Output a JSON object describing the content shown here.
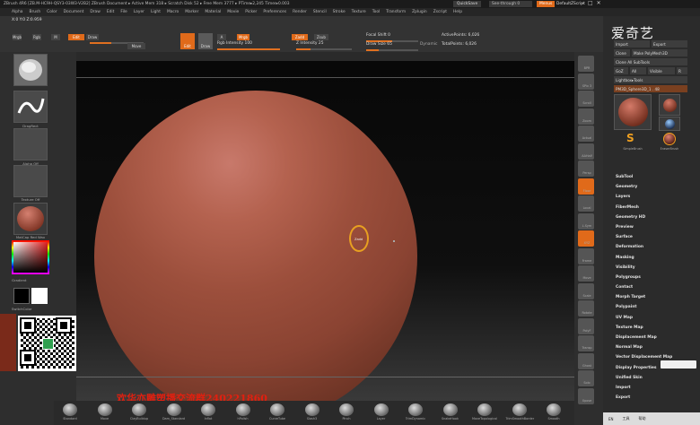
{
  "titlebar": {
    "text": "ZBrush 4R6 [ZB.M-HC9H-QSY3-03W3-V2B2]   ZBrush Document   ▸ Active Mem 318 ▸ Scratch Disk 52 ▸ Free Mem 3777 ▸ PTime▸2,245 Timer▸0.003",
    "quicksave": "QuickSave",
    "see_through": "See-through 0",
    "menus": "Menus",
    "default_script": "DefaultZScript",
    "window_buttons": [
      "–",
      "□",
      "✕"
    ]
  },
  "menubar": {
    "items": [
      "Alpha",
      "Brush",
      "Color",
      "Document",
      "Draw",
      "Edit",
      "File",
      "Layer",
      "Light",
      "Macro",
      "Marker",
      "Material",
      "Movie",
      "Picker",
      "Preferences",
      "Render",
      "Stencil",
      "Stroke",
      "Texture",
      "Tool",
      "Transform",
      "Zplugin",
      "Zscript",
      "Help"
    ]
  },
  "shelf": {
    "coords": "X:0 Y:0 Z:0.959",
    "mini_buttons": [
      "Mrgb",
      "Rgb",
      "M"
    ],
    "zadd": "Zadd",
    "zsub": "Zsub",
    "rgb_intensity": "Rgb Intensity 100",
    "z_intensity": "Z Intensity 25",
    "focal_shift": "Focal Shift 0",
    "draw_size": "Draw Size 65",
    "dynamic": "Dynamic",
    "active_points": "ActivePoints: 6,026",
    "total_points": "TotalPoints: 6,026",
    "edit_label": "Edit",
    "draw_label": "Draw",
    "move_label": "Move",
    "scale_label": "Scale",
    "rotate_label": "Rotate",
    "a_label": "A"
  },
  "left_shelf": {
    "brush_label": "Standard",
    "stroke_label": "DragRect",
    "alpha_label": "Alpha Off",
    "texture_label": "Texture Off",
    "material_label": "MatCap Red Wax",
    "gradient_label": "Gradient",
    "switch_color_label": "SwitchColor"
  },
  "canvas": {
    "brush_cursor_label": "Zadd",
    "watermark": "欢华亦雕塑播交流群240221860"
  },
  "right_icons": [
    {
      "name": "bpr",
      "label": "BPR"
    },
    {
      "name": "spix",
      "label": "SPix 3"
    },
    {
      "name": "scroll",
      "label": "Scroll"
    },
    {
      "name": "zoom",
      "label": "Zoom"
    },
    {
      "name": "actual",
      "label": "Actual"
    },
    {
      "name": "aahalf",
      "label": "AAHalf"
    },
    {
      "name": "persp",
      "label": "Persp"
    },
    {
      "name": "floor",
      "label": "Floor"
    },
    {
      "name": "local",
      "label": "Local"
    },
    {
      "name": "lsym",
      "label": "L.Sym"
    },
    {
      "name": "xyz",
      "label": "XYZ"
    },
    {
      "name": "frame",
      "label": "Frame"
    },
    {
      "name": "move",
      "label": "Move"
    },
    {
      "name": "scale",
      "label": "Scale"
    },
    {
      "name": "rotate",
      "label": "Rotate"
    },
    {
      "name": "polyf",
      "label": "PolyF"
    },
    {
      "name": "transp",
      "label": "Transp"
    },
    {
      "name": "ghost",
      "label": "Ghost"
    },
    {
      "name": "solo",
      "label": "Solo"
    },
    {
      "name": "xpose",
      "label": "Xpose"
    }
  ],
  "palette": {
    "watermark": "爱奇艺",
    "import": "Import",
    "export": "Export",
    "clone": "Clone",
    "make_polymesh": "Make PolyMesh3D",
    "clone_all": "Clone All SubTools",
    "goz": "GoZ",
    "all": "All",
    "visible": "Visible",
    "r": "R",
    "lightbox_tools": "Lightbox▸Tools",
    "current_tool": "PM3D_Sphere3D_1 . 48",
    "thumb_labels": [
      "PM3D_Sphere3D_1",
      "SimpleBrush",
      "AlphaBrush",
      "EraserBrush"
    ],
    "menu_items": [
      "SubTool",
      "Geometry",
      "Layers",
      "FiberMesh",
      "Geometry HD",
      "Preview",
      "Surface",
      "Deformation",
      "Masking",
      "Visibility",
      "Polygroups",
      "Contact",
      "Morph Target",
      "Polypaint",
      "UV Map",
      "Texture Map",
      "Displacement Map",
      "Normal Map",
      "Vector Displacement Map",
      "Display Properties",
      "Unified Skin",
      "Import",
      "Export"
    ]
  },
  "bottom_brushes": [
    "Standard",
    "Move",
    "ClayBuildup",
    "Dam_Standard",
    "Inflat",
    "hPolish",
    "CurveTube",
    "Slash3",
    "Pinch",
    "Layer",
    "TrimDynamic",
    "SnakeHook",
    "MoveTopological",
    "TrimSmoothBorder",
    "Smooth"
  ],
  "taskbar": {
    "items": [
      "EN",
      "工具",
      "帮助"
    ]
  }
}
